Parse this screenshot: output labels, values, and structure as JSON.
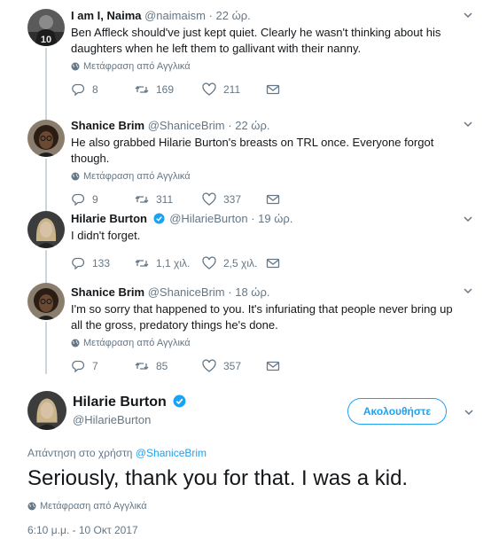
{
  "translate_label": "Μετάφραση από Αγγλικά",
  "tweets": [
    {
      "name": "I am I, Naima",
      "handle": "@naimaism",
      "sep": "·",
      "time": "22 ώρ.",
      "verified": false,
      "text": "Ben Affleck should've just kept quiet. Clearly he wasn't thinking about his daughters when he left them to gallivant with their nanny.",
      "replies": "8",
      "retweets": "169",
      "likes": "211",
      "avatar_badge": "10"
    },
    {
      "name": "Shanice Brim",
      "handle": "@ShaniceBrim",
      "sep": "·",
      "time": "22 ώρ.",
      "verified": false,
      "text": "He also grabbed Hilarie Burton's breasts on TRL once. Everyone forgot though.",
      "replies": "9",
      "retweets": "311",
      "likes": "337"
    },
    {
      "name": "Hilarie Burton",
      "handle": "@HilarieBurton",
      "sep": "·",
      "time": "19 ώρ.",
      "verified": true,
      "text": "I didn't forget.",
      "replies": "133",
      "retweets": "1,1 χιλ.",
      "likes": "2,5 χιλ."
    },
    {
      "name": "Shanice Brim",
      "handle": "@ShaniceBrim",
      "sep": "·",
      "time": "18 ώρ.",
      "verified": false,
      "text": "I'm so sorry that happened to you. It's infuriating that people never bring up all the gross, predatory things he's done.",
      "replies": "7",
      "retweets": "85",
      "likes": "357"
    }
  ],
  "main_tweet": {
    "name": "Hilarie Burton",
    "handle": "@HilarieBurton",
    "follow_label": "Ακολουθήστε",
    "reply_prefix": "Απάντηση στο χρήστη",
    "reply_to": "@ShaniceBrim",
    "text": "Seriously, thank you for that. I was a kid.",
    "date": "6:10 μ.μ. - 10 Οκτ 2017"
  },
  "colors": {
    "accent": "#1da1f2",
    "muted": "#657786",
    "text": "#14171a",
    "thread_line": "#ccd6dd"
  }
}
